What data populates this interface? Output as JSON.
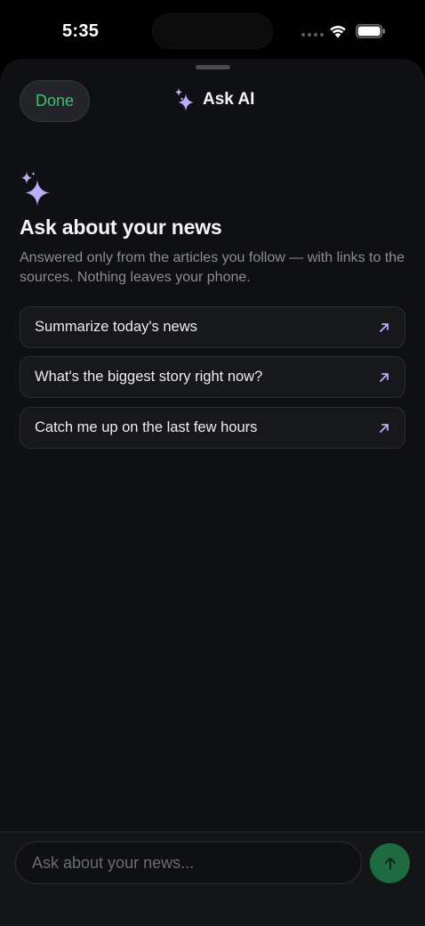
{
  "status_bar": {
    "time": "5:35"
  },
  "header": {
    "done_label": "Done",
    "title": "Ask AI",
    "title_icon": "sparkle-icon"
  },
  "intro": {
    "icon": "sparkle-icon",
    "headline": "Ask about your news",
    "subtext": "Answered only from the articles you follow — with links to the sources. Nothing leaves your phone."
  },
  "suggestions": [
    {
      "label": "Summarize today's news",
      "icon": "arrow-up-right-icon"
    },
    {
      "label": "What's the biggest story right now?",
      "icon": "arrow-up-right-icon"
    },
    {
      "label": "Catch me up on the last few hours",
      "icon": "arrow-up-right-icon"
    }
  ],
  "composer": {
    "placeholder": "Ask about your news...",
    "value": "",
    "send_icon": "arrow-up-icon"
  },
  "colors": {
    "accent_green": "#3fbf6b",
    "sparkle_purple": "#b9aef7",
    "send_button": "#1e6b3f",
    "sheet_background": "#0f1013"
  }
}
